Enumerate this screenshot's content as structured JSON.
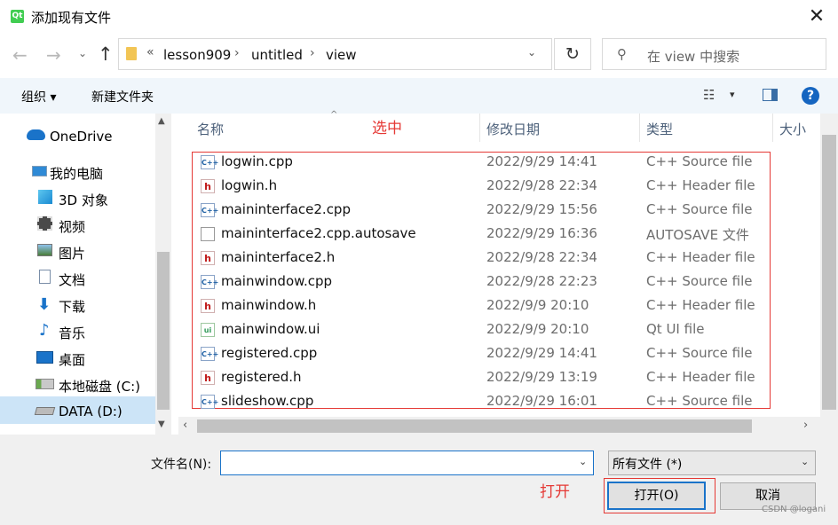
{
  "window": {
    "title": "添加现有文件",
    "app_icon": "Qt",
    "close": "✕"
  },
  "nav_buttons": {
    "back": "←",
    "forward": "→",
    "recent": "⌄",
    "up": "↑"
  },
  "address": {
    "root": "«",
    "crumbs": [
      "lesson909",
      "untitled",
      "view"
    ],
    "separator": "›",
    "dropdown": "⌄",
    "refresh": "↻"
  },
  "search": {
    "placeholder": "在 view 中搜索",
    "icon": "search-icon"
  },
  "toolbar": {
    "organize": "组织 ▾",
    "new_folder": "新建文件夹",
    "view_icon": "☷",
    "view_drop": "▾",
    "help": "?"
  },
  "nav": {
    "items": [
      {
        "label": "OneDrive",
        "icon": "cloud-icon"
      },
      {
        "label": "我的电脑",
        "icon": "computer-icon"
      },
      {
        "label": "3D 对象",
        "icon": "3d-objects-icon"
      },
      {
        "label": "视频",
        "icon": "video-icon"
      },
      {
        "label": "图片",
        "icon": "pictures-icon"
      },
      {
        "label": "文档",
        "icon": "documents-icon"
      },
      {
        "label": "下载",
        "icon": "download-icon"
      },
      {
        "label": "音乐",
        "icon": "music-icon"
      },
      {
        "label": "桌面",
        "icon": "desktop-icon"
      },
      {
        "label": "本地磁盘 (C:)",
        "icon": "drive-c-icon"
      },
      {
        "label": "DATA (D:)",
        "icon": "drive-d-icon",
        "selected": true
      }
    ]
  },
  "columns": {
    "name": "名称",
    "date": "修改日期",
    "type": "类型",
    "size": "大小"
  },
  "annotations": {
    "select": "选中",
    "open": "打开"
  },
  "files": [
    {
      "name": "logwin.cpp",
      "date": "2022/9/29 14:41",
      "type": "C++ Source file",
      "icon": "cpp"
    },
    {
      "name": "logwin.h",
      "date": "2022/9/28 22:34",
      "type": "C++ Header file",
      "icon": "h"
    },
    {
      "name": "maininterface2.cpp",
      "date": "2022/9/29 15:56",
      "type": "C++ Source file",
      "icon": "cpp"
    },
    {
      "name": "maininterface2.cpp.autosave",
      "date": "2022/9/29 16:36",
      "type": "AUTOSAVE 文件",
      "icon": "txt"
    },
    {
      "name": "maininterface2.h",
      "date": "2022/9/28 22:34",
      "type": "C++ Header file",
      "icon": "h"
    },
    {
      "name": "mainwindow.cpp",
      "date": "2022/9/28 22:23",
      "type": "C++ Source file",
      "icon": "cpp"
    },
    {
      "name": "mainwindow.h",
      "date": "2022/9/9 20:10",
      "type": "C++ Header file",
      "icon": "h"
    },
    {
      "name": "mainwindow.ui",
      "date": "2022/9/9 20:10",
      "type": "Qt UI file",
      "icon": "ui"
    },
    {
      "name": "registered.cpp",
      "date": "2022/9/29 14:41",
      "type": "C++ Source file",
      "icon": "cpp"
    },
    {
      "name": "registered.h",
      "date": "2022/9/29 13:19",
      "type": "C++ Header file",
      "icon": "h"
    },
    {
      "name": "slideshow.cpp",
      "date": "2022/9/29 16:01",
      "type": "C++ Source file",
      "icon": "cpp"
    }
  ],
  "bottom": {
    "filename_label": "文件名(N):",
    "filename_value": "",
    "filetype": "所有文件 (*)",
    "open": "打开(O)",
    "cancel": "取消"
  },
  "watermark": "CSDN @logani",
  "colors": {
    "accent": "#1a73c9",
    "annotation": "#e53935",
    "selected_bg": "#cce4f7"
  }
}
